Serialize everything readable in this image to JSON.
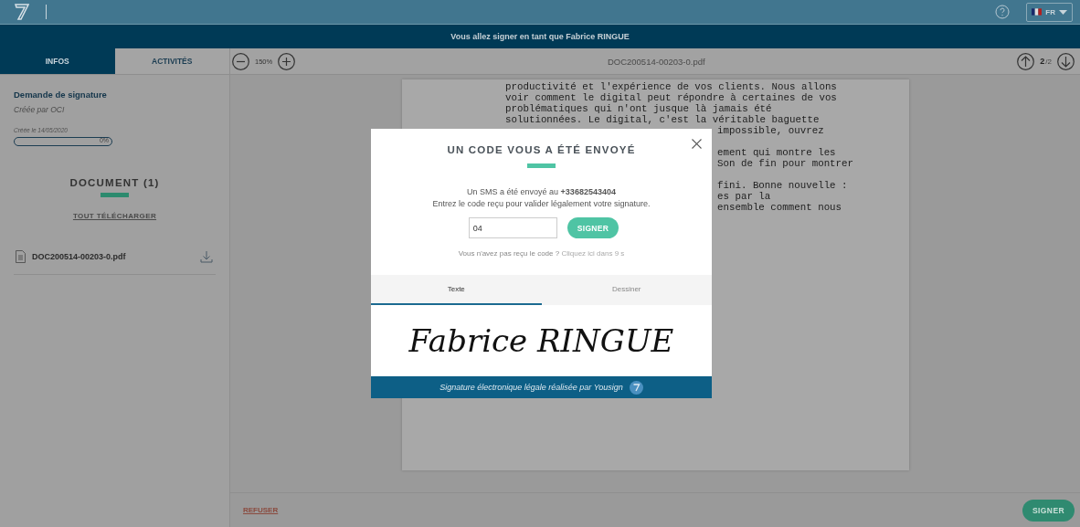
{
  "header": {
    "language": "FR"
  },
  "banner": "Vous allez signer en tant que Fabrice RINGUE",
  "sidebar": {
    "tabs": [
      {
        "label": "INFOS",
        "selected": true
      },
      {
        "label": "ACTIVITÉS",
        "selected": false
      }
    ],
    "request_title": "Demande de signature",
    "created_by": "Créée par OCI",
    "created_on": "Créée le 14/05/2020",
    "progress": {
      "level": 0,
      "reading": "0%"
    },
    "documents_heading": "DOCUMENT (1)",
    "download_all": "TOUT TÉLÉCHARGER",
    "files": [
      {
        "name": "DOC200514-00203-0.pdf"
      }
    ]
  },
  "viewer": {
    "zoom": "150%",
    "filename": "DOC200514-00203-0.pdf",
    "page": "2",
    "page_count": "/2",
    "lines": [
      {
        "kind": "full",
        "text": "productivité et l'expérience de vos clients. Nous allons"
      },
      {
        "kind": "full",
        "text": "voir comment le digital peut répondre à certaines de vos"
      },
      {
        "kind": "full",
        "text": "problématiques qui n'ont jusque là jamais été"
      },
      {
        "kind": "full",
        "text": "solutionnées. Le digital, c'est la véritable baguette"
      },
      {
        "kind": "partial",
        "text": "impossible, ouvrez"
      },
      {
        "kind": "blank"
      },
      {
        "kind": "partial",
        "text": "ement qui montre les"
      },
      {
        "kind": "partial",
        "text": "Son de fin pour montrer"
      },
      {
        "kind": "blank"
      },
      {
        "kind": "partial",
        "text": "fini. Bonne nouvelle :"
      },
      {
        "kind": "partial",
        "text": "es par la"
      },
      {
        "kind": "partial",
        "text": "ensemble comment nous"
      }
    ]
  },
  "modal": {
    "title": "UN CODE VOUS A ÉTÉ ENVOYÉ",
    "sms_text": "Un SMS a été envoyé au **+33682543404**",
    "instruction": "Entrez le code reçu pour valider légalement votre signature.",
    "code": {
      "value": "04"
    },
    "submit": "SIGNER",
    "resend": "Vous n'avez pas reçu le code ?",
    "resend_link": "Cliquez ici dans 9 s",
    "tabs": [
      {
        "label": "Texte",
        "selected": true
      },
      {
        "label": "Dessiner",
        "selected": false
      }
    ],
    "signature": "Fabrice RINGUE",
    "footer": "Signature électronique légale réalisée par Yousign"
  },
  "footer": {
    "refuse": "REFUSER",
    "sign": "SIGNER"
  }
}
